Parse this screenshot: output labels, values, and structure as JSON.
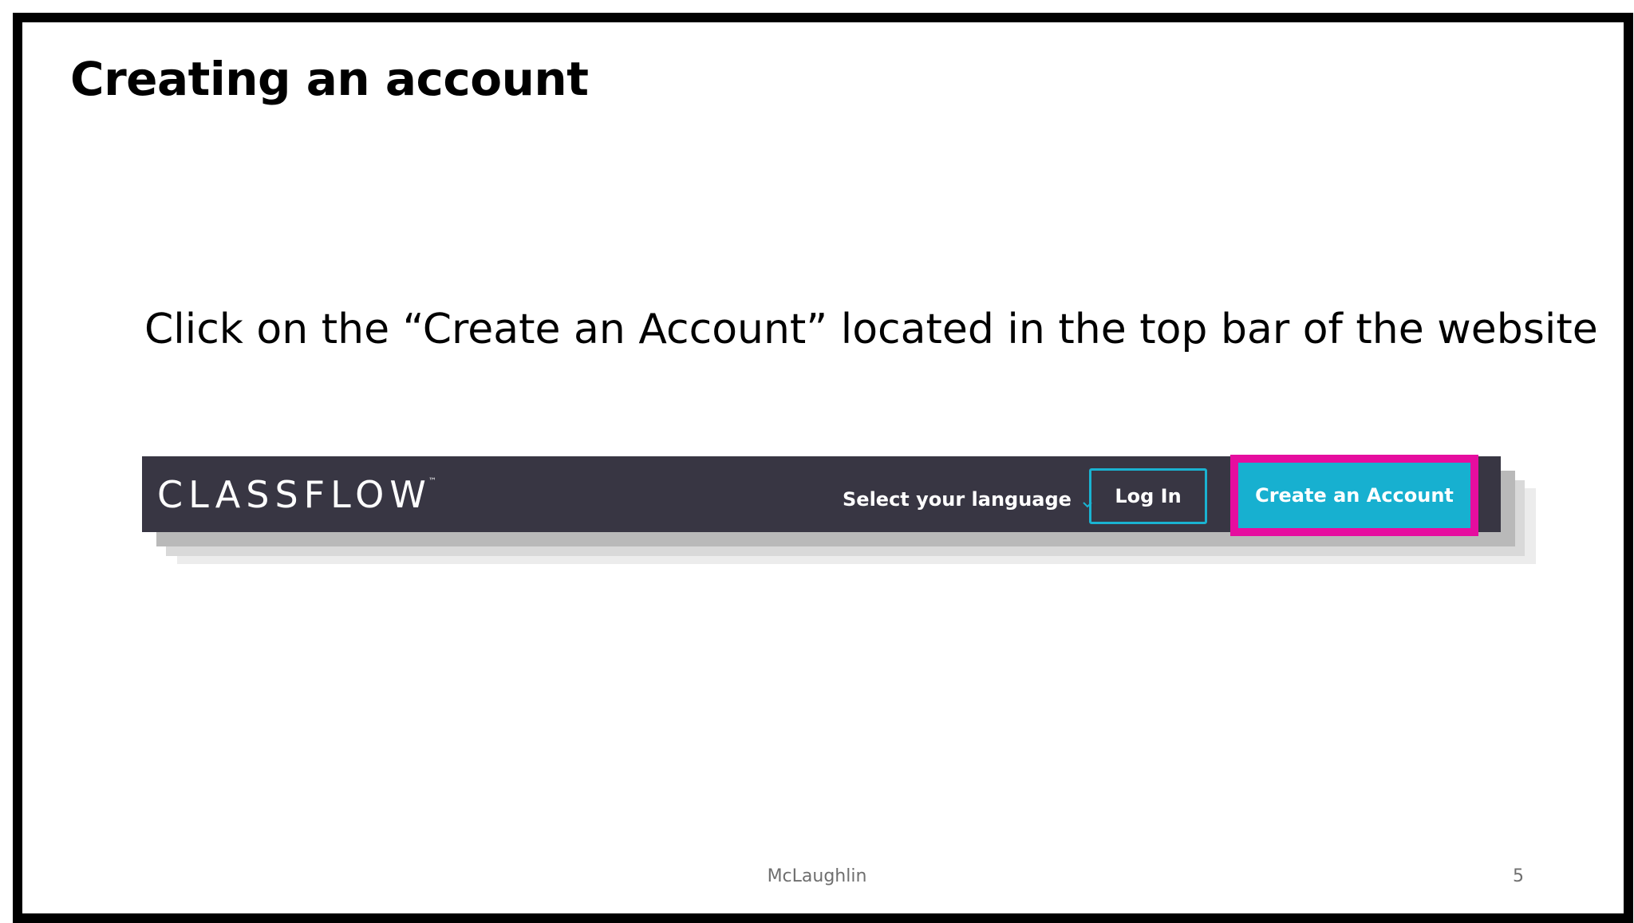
{
  "slide": {
    "title": "Creating an account",
    "instruction": "Click on the “Create an Account” located in the top bar of the website",
    "footer_author": "McLaughlin",
    "page_number": "5"
  },
  "screenshot": {
    "brand": "CLASSFLOW",
    "brand_trademark": "™",
    "language_label": "Select your language",
    "login_label": "Log In",
    "create_account_label": "Create an Account",
    "icons": [
      "chevron-down-icon"
    ],
    "colors": {
      "navbar": "#383643",
      "accent": "#17b0d0",
      "highlight": "#e60d9f"
    }
  }
}
